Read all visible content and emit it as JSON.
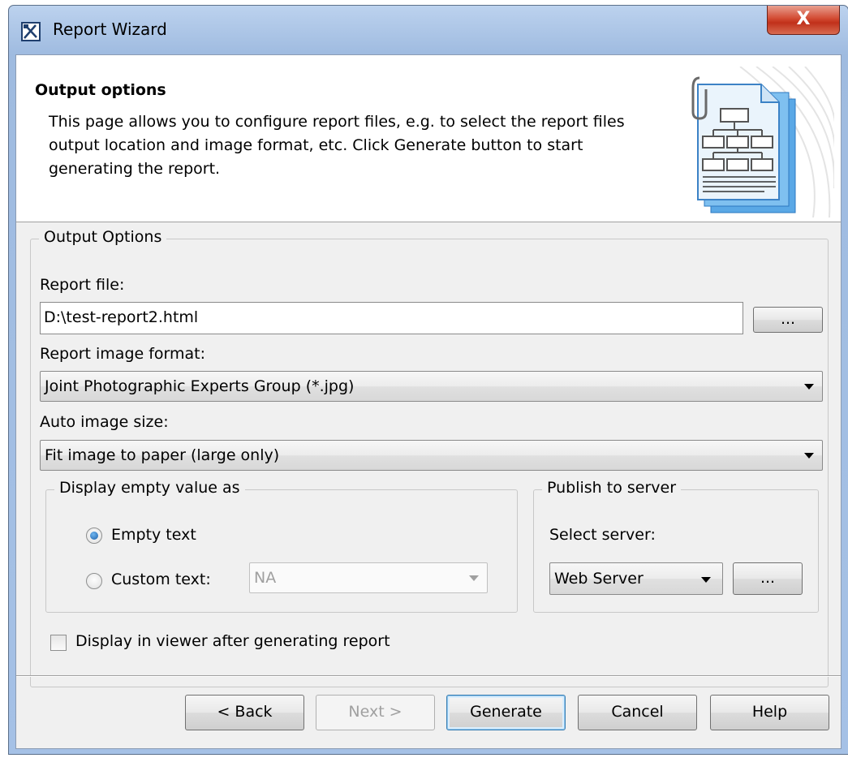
{
  "window": {
    "title": "Report Wizard",
    "close_label": "X"
  },
  "header": {
    "title": "Output options",
    "description": "This page allows you to configure report files, e.g. to select the report files output location and image format, etc. Click Generate button to start generating the report."
  },
  "output_options": {
    "group_label": "Output Options",
    "report_file_label": "Report file:",
    "report_file_value": "D:\\test-report2.html",
    "browse_label": "...",
    "image_format_label": "Report image format:",
    "image_format_value": "Joint Photographic Experts Group (*.jpg)",
    "auto_size_label": "Auto image size:",
    "auto_size_value": "Fit image to paper (large only)"
  },
  "display_empty": {
    "group_label": "Display empty value as",
    "empty_text_label": "Empty text",
    "custom_text_label": "Custom text:",
    "custom_text_value": "NA",
    "selected": "empty_text"
  },
  "publish": {
    "group_label": "Publish to server",
    "select_server_label": "Select server:",
    "server_value": "Web Server",
    "browse_label": "..."
  },
  "viewer_checkbox_label": "Display in viewer after generating report",
  "footer": {
    "back_label": "< Back",
    "next_label": "Next >",
    "generate_label": "Generate",
    "cancel_label": "Cancel",
    "help_label": "Help"
  }
}
